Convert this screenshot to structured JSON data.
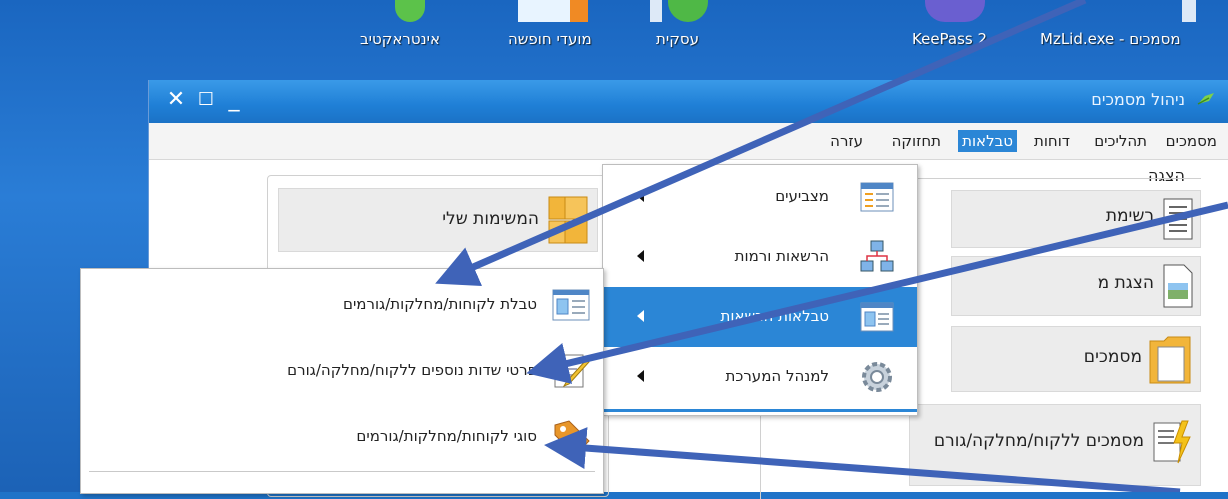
{
  "desktop": {
    "icons": [
      {
        "label": "אינטראקטיב"
      },
      {
        "label": "מועדי חופשה"
      },
      {
        "label": "עסקית"
      },
      {
        "label": "KeePass 2"
      },
      {
        "label": "MzLid.exe - מסמכים"
      }
    ]
  },
  "window": {
    "title": "ניהול מסמכים",
    "controls": {
      "close": "✕",
      "maximize": "☐",
      "minimize": "_"
    }
  },
  "menubar": {
    "items": [
      {
        "label": "מסמכים"
      },
      {
        "label": "תהליכים"
      },
      {
        "label": "דוחות"
      },
      {
        "label": "טבלאות",
        "selected": true
      },
      {
        "label": "תחזוקה"
      },
      {
        "label": "עזרה"
      }
    ]
  },
  "content": {
    "group_title": "הצגה",
    "right_buttons": [
      {
        "label": "רשימת",
        "icon": "document-list-icon"
      },
      {
        "label": "הצגת מ",
        "icon": "image-document-icon"
      },
      {
        "label": "מסמכים",
        "icon": "folder-icon"
      },
      {
        "label": "מסמכים ללקוח/מחלקה/גורם",
        "icon": "lightning-document-icon"
      }
    ],
    "left_buttons": [
      {
        "label": "המשימות שלי",
        "icon": "folders-icon"
      }
    ]
  },
  "tables_menu": {
    "items": [
      {
        "label": "מצביעים",
        "icon": "table-icon"
      },
      {
        "label": "הרשאות ורמות",
        "icon": "network-icon"
      },
      {
        "label": "טבלאות הרשאות",
        "icon": "contact-card-icon",
        "highlighted": true
      },
      {
        "label": "למנהל המערכת",
        "icon": "gear-icon"
      }
    ]
  },
  "submenu": {
    "items": [
      {
        "label": "טבלת לקוחות/מחלקות/גורמים",
        "icon": "contact-card-icon"
      },
      {
        "label": "פרטי שדות נוספים ללקוח/מחלקה/גורם",
        "icon": "edit-document-icon"
      },
      {
        "label": "סוגי לקוחות/מחלקות/גורמים",
        "icon": "tag-icon"
      }
    ]
  },
  "colors": {
    "menu_highlight": "#2b86d6",
    "title_bar": "#1f7fd6",
    "annotation_arrow": "#3f63b8"
  }
}
